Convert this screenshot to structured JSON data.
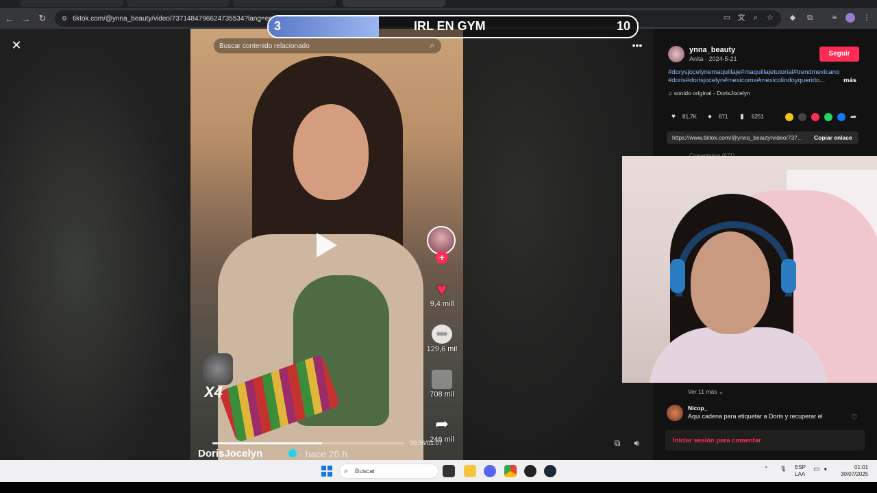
{
  "browser": {
    "url": "tiktok.com/@ynna_beauty/video/7371484796624735534?lang=es&q="
  },
  "overlay": {
    "left_value": "3",
    "title": "IRL EN GYM",
    "right_value": "10",
    "progress_fraction": 0.3
  },
  "video": {
    "search_placeholder": "Buscar contenido relacionado",
    "author_name": "DorisJocelyn",
    "posted": "· hace 20 h",
    "time": "00:36/01:07",
    "likes": "9,4 mill",
    "comments": "129,6 mil",
    "saves": "708 mil",
    "shares": "246 mil",
    "multiplier": "X4"
  },
  "panel": {
    "username": "ynna_beauty",
    "meta": "Anita · 2024-5-21",
    "follow_label": "Seguir",
    "hashtags": "#dorysjocelynemaquillaje#maquillajetutorial#trendmexicano #doris#dorisjocelyn#mexicomx#mexicolindoyquerido...",
    "more_label": "más",
    "sound": "sonido original - DorisJocelyn",
    "stats": {
      "likes": "81,7K",
      "comments": "871",
      "saves": "6251"
    },
    "link": "https://www.tiktok.com/@ynna_beauty/video/737...",
    "copy_label": "Copiar enlace",
    "tabs_hint": "Comentarios (871)",
    "see_more": "Ver 11 más",
    "comment_user": "Nicop_",
    "comment_text": "Aqui cadena para etiquetar a Doris y recuperar el",
    "login_label": "Iniciar sesión para comentar"
  },
  "taskbar": {
    "search_label": "Buscar",
    "lang_top": "ESP",
    "lang_bottom": "LAA",
    "time": "01:01",
    "date": "30/07/2025"
  },
  "colors": {
    "accent": "#fe2c55",
    "hashtag": "#8fb8ff",
    "overlay_fill": "#7b97dc"
  }
}
